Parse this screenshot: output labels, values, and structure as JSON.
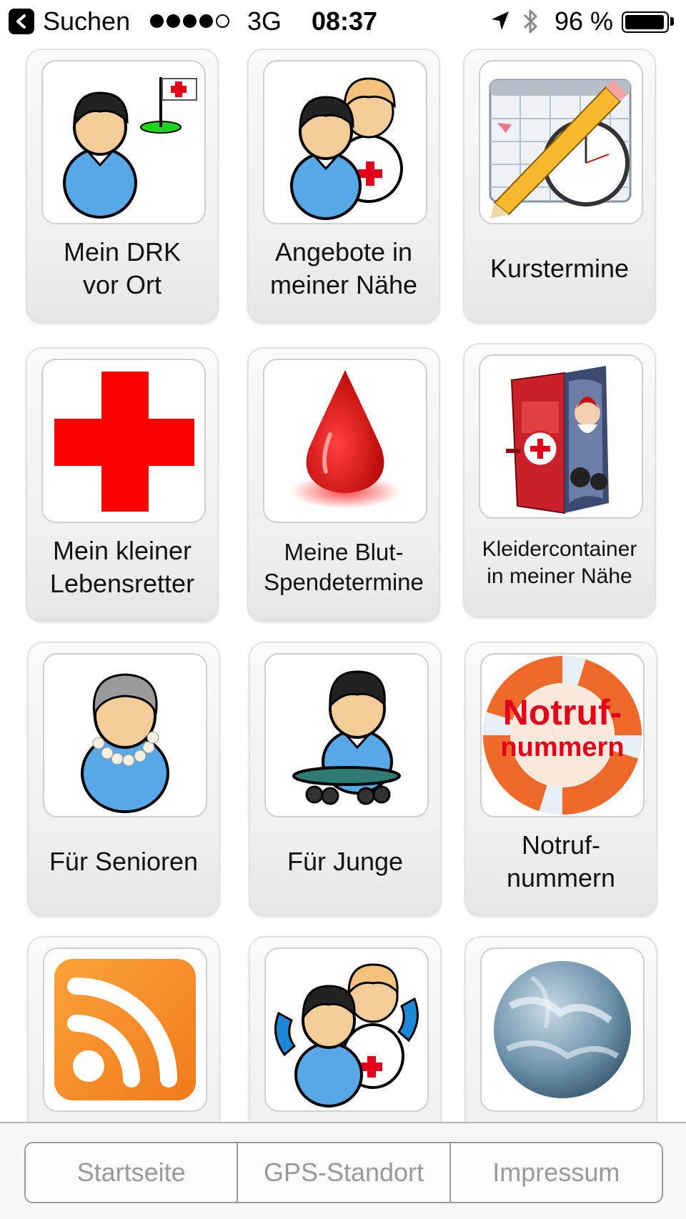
{
  "status_bar": {
    "back_label": "Suchen",
    "signal_bars_filled": 4,
    "signal_bars_total": 5,
    "network": "3G",
    "time": "08:37",
    "battery_text": "96 %",
    "battery_level": 0.96,
    "icons": [
      "back-arrow-icon",
      "location-arrow-icon",
      "bluetooth-icon",
      "battery-icon"
    ]
  },
  "tiles": [
    {
      "label": "Mein DRK\nvor Ort",
      "icon": "person-with-flag-icon"
    },
    {
      "label": "Angebote in\nmeiner Nähe",
      "icon": "two-persons-red-cross-icon"
    },
    {
      "label": "Kurstermine",
      "icon": "calendar-clock-pencil-icon"
    },
    {
      "label": "Mein kleiner\nLebensretter",
      "icon": "red-cross-icon"
    },
    {
      "label": "Meine Blut-\nSpendetermine",
      "icon": "blood-drop-icon"
    },
    {
      "label": "Kleidercontainer\nin meiner Nähe",
      "icon": "clothing-container-icon"
    },
    {
      "label": "Für Senioren",
      "icon": "senior-person-icon"
    },
    {
      "label": "Für Junge",
      "icon": "person-skateboard-icon"
    },
    {
      "label": "Notruf-\nnummern",
      "icon": "lifebuoy-icon",
      "icon_text_1": "Notruf-",
      "icon_text_2": "nummern"
    },
    {
      "label": "",
      "icon": "rss-feed-icon"
    },
    {
      "label": "",
      "icon": "persons-phone-icon"
    },
    {
      "label": "",
      "icon": "globe-icon"
    }
  ],
  "bottom_nav": {
    "items": [
      "Startseite",
      "GPS-Standort",
      "Impressum"
    ]
  },
  "colors": {
    "drk_red": "#e2001a",
    "nav_text": "#999999"
  }
}
